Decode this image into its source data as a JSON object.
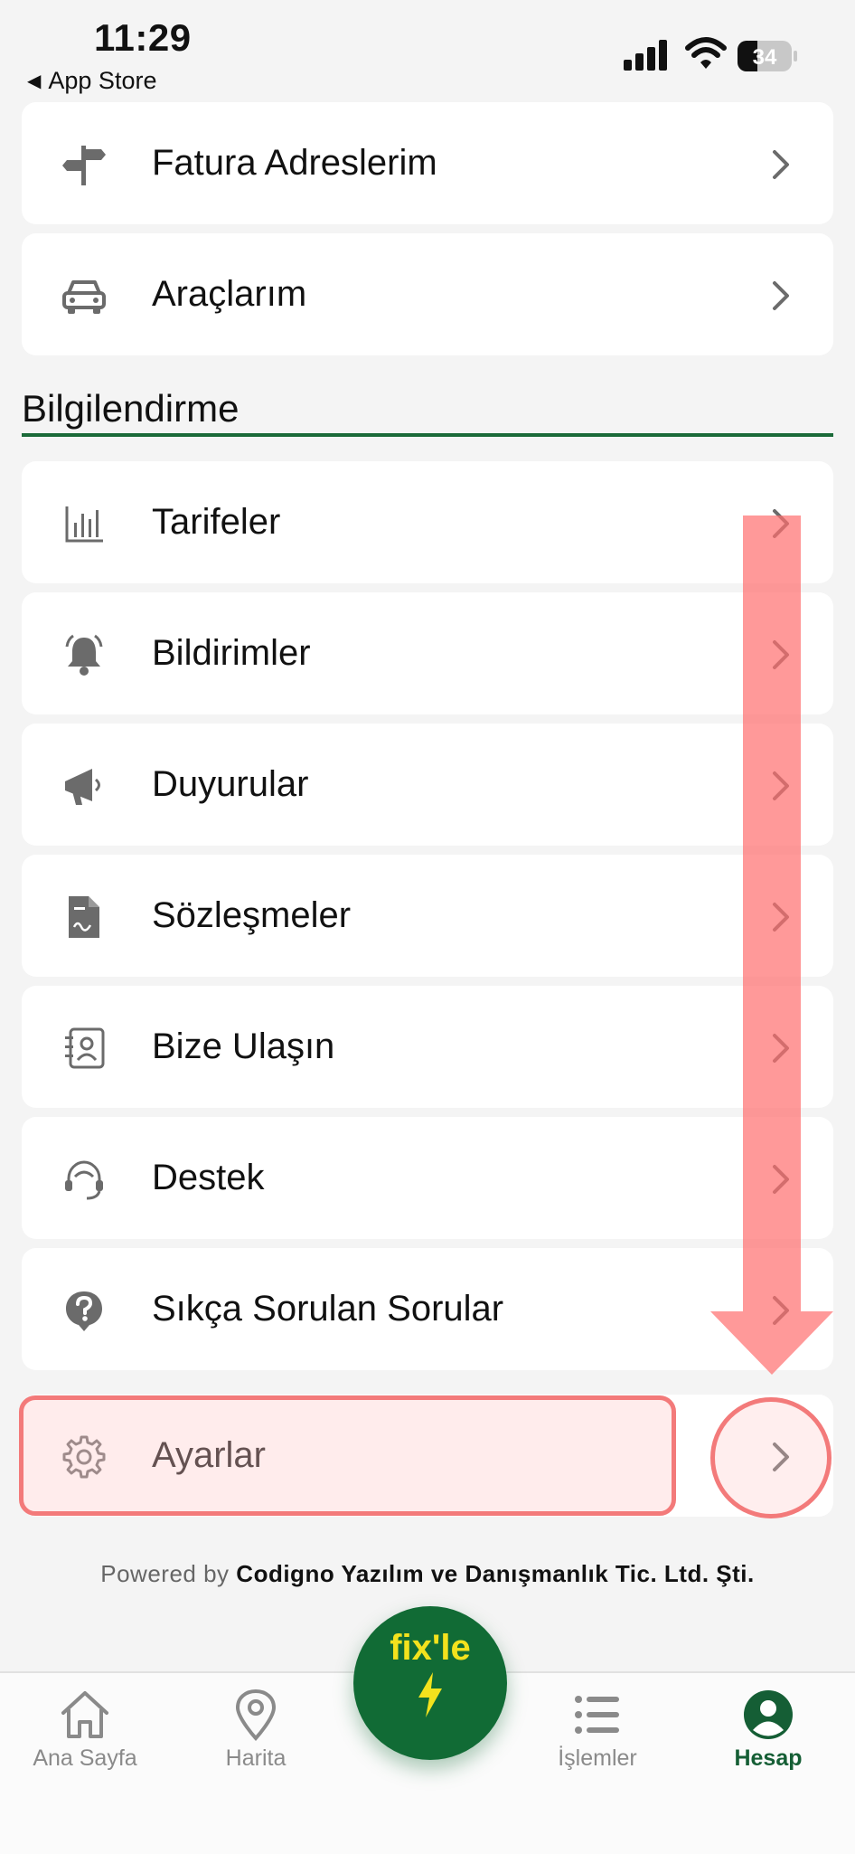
{
  "status_bar": {
    "time": "11:29",
    "back_label": "App Store",
    "battery": "34"
  },
  "top_items": [
    {
      "label": "Fatura Adreslerim",
      "icon": "signpost-icon"
    },
    {
      "label": "Araçlarım",
      "icon": "car-icon"
    }
  ],
  "section": {
    "title": "Bilgilendirme"
  },
  "info_items": [
    {
      "label": "Tarifeler",
      "icon": "bar-chart-icon"
    },
    {
      "label": "Bildirimler",
      "icon": "bell-icon"
    },
    {
      "label": "Duyurular",
      "icon": "megaphone-icon"
    },
    {
      "label": "Sözleşmeler",
      "icon": "contract-icon"
    },
    {
      "label": "Bize Ulaşın",
      "icon": "contact-card-icon"
    },
    {
      "label": "Destek",
      "icon": "headset-icon"
    },
    {
      "label": "Sıkça Sorulan Sorular",
      "icon": "question-icon"
    },
    {
      "label": "Ayarlar",
      "icon": "gear-icon"
    }
  ],
  "footer": {
    "powered_prefix": "Powered by",
    "company": "Codigno Yazılım ve Danışmanlık Tic. Ltd. Şti."
  },
  "tabbar": {
    "tabs": [
      {
        "label": "Ana Sayfa",
        "icon": "home-icon"
      },
      {
        "label": "Harita",
        "icon": "map-pin-icon"
      },
      {
        "label": "İşlemler",
        "icon": "list-icon"
      },
      {
        "label": "Hesap",
        "icon": "account-icon"
      }
    ],
    "fab_label": "fix'le",
    "active_tab": "Hesap"
  },
  "colors": {
    "brand_green": "#116b35",
    "fab_text": "#f3e21d",
    "highlight": "#f37a7a"
  }
}
